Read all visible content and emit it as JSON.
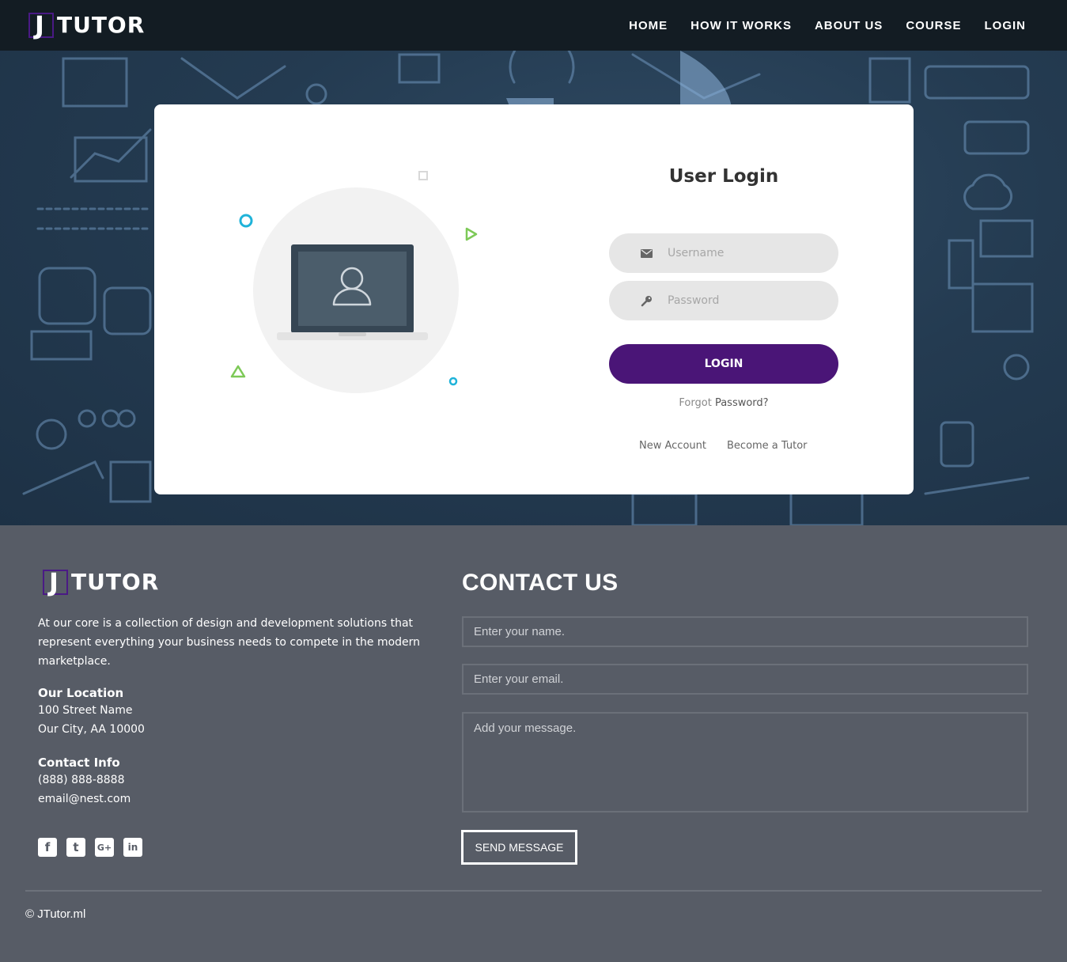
{
  "brand": {
    "mark": "J",
    "word": "TUTOR",
    "accent_color": "#4a1a85"
  },
  "nav": {
    "items": [
      {
        "label": "HOME"
      },
      {
        "label": "HOW IT WORKS"
      },
      {
        "label": "ABOUT US"
      },
      {
        "label": "COURSE"
      },
      {
        "label": "LOGIN"
      }
    ]
  },
  "login": {
    "title": "User Login",
    "username": {
      "placeholder": "Username",
      "icon": "envelope-icon"
    },
    "password": {
      "placeholder": "Password",
      "icon": "key-icon"
    },
    "button_label": "LOGIN",
    "button_color": "#4a1577",
    "forgot_prefix": "Forgot",
    "forgot_link": "Password?",
    "new_account": "New Account",
    "become_tutor": "Become a Tutor",
    "illustration_icon": "laptop-user-icon"
  },
  "footer": {
    "about": "At our core is a collection of design and development solutions that represent everything your business needs to compete in the modern marketplace.",
    "location_heading": "Our Location",
    "address_line1": "100 Street Name",
    "address_line2": "Our City, AA 10000",
    "contact_heading": "Contact Info",
    "phone": "(888) 888-8888",
    "email": "email@nest.com",
    "social": [
      {
        "icon": "facebook-icon",
        "glyph": "f"
      },
      {
        "icon": "twitter-icon",
        "glyph": "t"
      },
      {
        "icon": "google-plus-icon",
        "glyph": "G+"
      },
      {
        "icon": "linkedin-icon",
        "glyph": "in"
      }
    ],
    "copyright": "© JTutor.ml"
  },
  "contact": {
    "title": "CONTACT US",
    "name_placeholder": "Enter your name.",
    "email_placeholder": "Enter your email.",
    "message_placeholder": "Add your message.",
    "send_label": "SEND MESSAGE"
  }
}
